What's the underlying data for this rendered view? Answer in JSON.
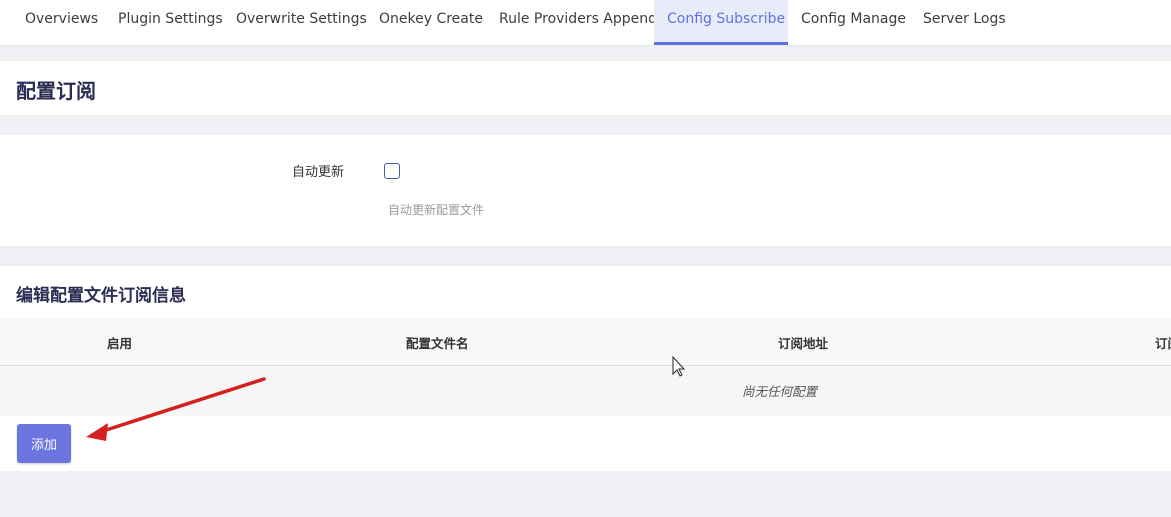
{
  "tabs": [
    {
      "label": "Overviews"
    },
    {
      "label": "Plugin Settings"
    },
    {
      "label": "Overwrite Settings"
    },
    {
      "label": "Onekey Create"
    },
    {
      "label": "Rule Providers Append"
    },
    {
      "label": "Config Subscribe",
      "active": true
    },
    {
      "label": "Config Manage"
    },
    {
      "label": "Server Logs"
    }
  ],
  "page_title": "配置订阅",
  "settings": {
    "auto_update_label": "自动更新",
    "auto_update_checked": false,
    "auto_update_hint": "自动更新配置文件"
  },
  "subscription": {
    "section_title": "编辑配置文件订阅信息",
    "columns": [
      "启用",
      "配置文件名",
      "订阅地址",
      "订阅"
    ],
    "empty_text": "尚无任何配置",
    "add_button": "添加"
  },
  "colors": {
    "accent": "#5e72e4",
    "button": "#6c74e0",
    "annotation_arrow": "#d42020"
  }
}
